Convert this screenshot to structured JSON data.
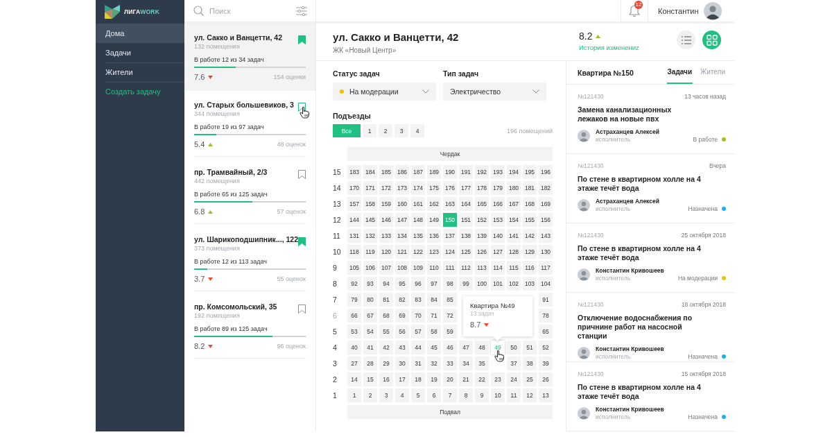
{
  "logo": {
    "prefix": "ЛИГА",
    "suffix": "WORK"
  },
  "nav": [
    {
      "label": "Дома",
      "selected": true,
      "kind": "item"
    },
    {
      "label": "Задачи",
      "selected": false,
      "kind": "item"
    },
    {
      "label": "Жители",
      "selected": false,
      "kind": "item"
    },
    {
      "label": "Создать задачу",
      "selected": false,
      "kind": "action"
    }
  ],
  "search": {
    "placeholder": "Поиск"
  },
  "houses": [
    {
      "title": "ул. Сакко и Ванцетти, 42",
      "rooms": "132 помещения",
      "progress": "В работе 12 из 34 задач",
      "level": 0.37,
      "rating": "7.6",
      "rising": false,
      "votes": "154 оценки",
      "selected": true,
      "bookmarked": true,
      "hovered": false
    },
    {
      "title": "ул. Старых большевиков, 3",
      "rooms": "344 помещения",
      "progress": "В работе 19 из 97 задач",
      "level": 0.2,
      "rating": "5.4",
      "rising": true,
      "votes": "48 оценок",
      "selected": false,
      "bookmarked": false,
      "hovered": true
    },
    {
      "title": "пр. Трамвайный, 2/3",
      "rooms": "442 помещения",
      "progress": "В работе 65 из 125 задач",
      "level": 0.52,
      "rating": "6.8",
      "rising": true,
      "votes": "57 оценок",
      "selected": false,
      "bookmarked": false,
      "hovered": false
    },
    {
      "title": "ул. Шарикоподшипник..., 122",
      "rooms": "373 помещения",
      "progress": "В работе 12 из 113 задач",
      "level": 0.12,
      "rating": "3.7",
      "rising": false,
      "votes": "55 оценок",
      "selected": false,
      "bookmarked": true,
      "hovered": false
    },
    {
      "title": "пр. Комсомольский, 35",
      "rooms": "192 помещения",
      "progress": "В работе 89 из 125 задач",
      "level": 0.7,
      "rating": "8.2",
      "rising": false,
      "votes": "96 оценок",
      "selected": false,
      "bookmarked": false,
      "hovered": false
    }
  ],
  "topbar": {
    "notifications": "12",
    "user": "Константин"
  },
  "house": {
    "title": "ул. Сакко и Ванцетти, 42",
    "subtitle": "ЖК «Новый Центр»",
    "rating": "8.2",
    "rising": true,
    "history_link": "История изменениz"
  },
  "view_modes": [
    {
      "kind": "list",
      "selected": false
    },
    {
      "kind": "grid",
      "selected": true
    }
  ],
  "filters": [
    {
      "label": "Статус задач",
      "value": "На модерации",
      "color": "#f5c000"
    },
    {
      "label": "Тип задач",
      "value": "Электричество"
    }
  ],
  "entrances": {
    "label": "Подъезды",
    "buttons": [
      {
        "label": "Все",
        "selected": true
      },
      {
        "label": "1",
        "selected": false
      },
      {
        "label": "2",
        "selected": false
      },
      {
        "label": "3",
        "selected": false
      },
      {
        "label": "4",
        "selected": false
      }
    ],
    "count": "196 помещений"
  },
  "building": {
    "attic": "Чердак",
    "basement": "Подвал",
    "floors": [
      {
        "floor": "15",
        "dimmed": false,
        "cells": [
          {
            "n": "183",
            "selected": false,
            "hovered": false
          },
          {
            "n": "184",
            "selected": false,
            "hovered": false
          },
          {
            "n": "185",
            "selected": false,
            "hovered": false
          },
          {
            "n": "186",
            "selected": false,
            "hovered": false
          },
          {
            "n": "187",
            "selected": false,
            "hovered": false
          },
          {
            "n": "189",
            "selected": false,
            "hovered": false
          },
          {
            "n": "190",
            "selected": false,
            "hovered": false
          },
          {
            "n": "191",
            "selected": false,
            "hovered": false
          },
          {
            "n": "192",
            "selected": false,
            "hovered": false
          },
          {
            "n": "193",
            "selected": false,
            "hovered": false
          },
          {
            "n": "194",
            "selected": false,
            "hovered": false
          },
          {
            "n": "195",
            "selected": false,
            "hovered": false
          },
          {
            "n": "196",
            "selected": false,
            "hovered": false
          }
        ]
      },
      {
        "floor": "14",
        "dimmed": false,
        "cells": [
          {
            "n": "170",
            "selected": false,
            "hovered": false
          },
          {
            "n": "171",
            "selected": false,
            "hovered": false
          },
          {
            "n": "172",
            "selected": false,
            "hovered": false
          },
          {
            "n": "173",
            "selected": false,
            "hovered": false
          },
          {
            "n": "174",
            "selected": false,
            "hovered": false
          },
          {
            "n": "175",
            "selected": false,
            "hovered": false
          },
          {
            "n": "176",
            "selected": false,
            "hovered": false
          },
          {
            "n": "177",
            "selected": false,
            "hovered": false
          },
          {
            "n": "178",
            "selected": false,
            "hovered": false
          },
          {
            "n": "179",
            "selected": false,
            "hovered": false
          },
          {
            "n": "180",
            "selected": false,
            "hovered": false
          },
          {
            "n": "181",
            "selected": false,
            "hovered": false
          },
          {
            "n": "182",
            "selected": false,
            "hovered": false
          }
        ]
      },
      {
        "floor": "13",
        "dimmed": false,
        "cells": [
          {
            "n": "157",
            "selected": false,
            "hovered": false
          },
          {
            "n": "158",
            "selected": false,
            "hovered": false
          },
          {
            "n": "159",
            "selected": false,
            "hovered": false
          },
          {
            "n": "160",
            "selected": false,
            "hovered": false
          },
          {
            "n": "161",
            "selected": false,
            "hovered": false
          },
          {
            "n": "162",
            "selected": false,
            "hovered": false
          },
          {
            "n": "163",
            "selected": false,
            "hovered": false
          },
          {
            "n": "164",
            "selected": false,
            "hovered": false
          },
          {
            "n": "165",
            "selected": false,
            "hovered": false
          },
          {
            "n": "166",
            "selected": false,
            "hovered": false
          },
          {
            "n": "167",
            "selected": false,
            "hovered": false
          },
          {
            "n": "168",
            "selected": false,
            "hovered": false
          },
          {
            "n": "169",
            "selected": false,
            "hovered": false
          }
        ]
      },
      {
        "floor": "12",
        "dimmed": false,
        "cells": [
          {
            "n": "144",
            "selected": false,
            "hovered": false
          },
          {
            "n": "145",
            "selected": false,
            "hovered": false
          },
          {
            "n": "146",
            "selected": false,
            "hovered": false
          },
          {
            "n": "147",
            "selected": false,
            "hovered": false
          },
          {
            "n": "148",
            "selected": false,
            "hovered": false
          },
          {
            "n": "149",
            "selected": false,
            "hovered": false
          },
          {
            "n": "150",
            "selected": true,
            "hovered": false
          },
          {
            "n": "151",
            "selected": false,
            "hovered": false
          },
          {
            "n": "152",
            "selected": false,
            "hovered": false
          },
          {
            "n": "153",
            "selected": false,
            "hovered": false
          },
          {
            "n": "154",
            "selected": false,
            "hovered": false
          },
          {
            "n": "155",
            "selected": false,
            "hovered": false
          },
          {
            "n": "156",
            "selected": false,
            "hovered": false
          }
        ]
      },
      {
        "floor": "11",
        "dimmed": false,
        "cells": [
          {
            "n": "131",
            "selected": false,
            "hovered": false
          },
          {
            "n": "132",
            "selected": false,
            "hovered": false
          },
          {
            "n": "133",
            "selected": false,
            "hovered": false
          },
          {
            "n": "134",
            "selected": false,
            "hovered": false
          },
          {
            "n": "135",
            "selected": false,
            "hovered": false
          },
          {
            "n": "136",
            "selected": false,
            "hovered": false
          },
          {
            "n": "137",
            "selected": false,
            "hovered": false
          },
          {
            "n": "138",
            "selected": false,
            "hovered": false
          },
          {
            "n": "139",
            "selected": false,
            "hovered": false
          },
          {
            "n": "140",
            "selected": false,
            "hovered": false
          },
          {
            "n": "141",
            "selected": false,
            "hovered": false
          },
          {
            "n": "142",
            "selected": false,
            "hovered": false
          },
          {
            "n": "143",
            "selected": false,
            "hovered": false
          }
        ]
      },
      {
        "floor": "10",
        "dimmed": false,
        "cells": [
          {
            "n": "118",
            "selected": false,
            "hovered": false
          },
          {
            "n": "119",
            "selected": false,
            "hovered": false
          },
          {
            "n": "120",
            "selected": false,
            "hovered": false
          },
          {
            "n": "121",
            "selected": false,
            "hovered": false
          },
          {
            "n": "122",
            "selected": false,
            "hovered": false
          },
          {
            "n": "123",
            "selected": false,
            "hovered": false
          },
          {
            "n": "124",
            "selected": false,
            "hovered": false
          },
          {
            "n": "125",
            "selected": false,
            "hovered": false
          },
          {
            "n": "126",
            "selected": false,
            "hovered": false
          },
          {
            "n": "127",
            "selected": false,
            "hovered": false
          },
          {
            "n": "128",
            "selected": false,
            "hovered": false
          },
          {
            "n": "129",
            "selected": false,
            "hovered": false
          },
          {
            "n": "130",
            "selected": false,
            "hovered": false
          }
        ]
      },
      {
        "floor": "9",
        "dimmed": false,
        "cells": [
          {
            "n": "105",
            "selected": false,
            "hovered": false
          },
          {
            "n": "106",
            "selected": false,
            "hovered": false
          },
          {
            "n": "107",
            "selected": false,
            "hovered": false
          },
          {
            "n": "108",
            "selected": false,
            "hovered": false
          },
          {
            "n": "109",
            "selected": false,
            "hovered": false
          },
          {
            "n": "110",
            "selected": false,
            "hovered": false
          },
          {
            "n": "111",
            "selected": false,
            "hovered": false
          },
          {
            "n": "112",
            "selected": false,
            "hovered": false
          },
          {
            "n": "113",
            "selected": false,
            "hovered": false
          },
          {
            "n": "114",
            "selected": false,
            "hovered": false
          },
          {
            "n": "115",
            "selected": false,
            "hovered": false
          },
          {
            "n": "116",
            "selected": false,
            "hovered": false
          },
          {
            "n": "117",
            "selected": false,
            "hovered": false
          }
        ]
      },
      {
        "floor": "8",
        "dimmed": false,
        "cells": [
          {
            "n": "92",
            "selected": false,
            "hovered": false
          },
          {
            "n": "93",
            "selected": false,
            "hovered": false
          },
          {
            "n": "94",
            "selected": false,
            "hovered": false
          },
          {
            "n": "95",
            "selected": false,
            "hovered": false
          },
          {
            "n": "96",
            "selected": false,
            "hovered": false
          },
          {
            "n": "97",
            "selected": false,
            "hovered": false
          },
          {
            "n": "98",
            "selected": false,
            "hovered": false
          },
          {
            "n": "99",
            "selected": false,
            "hovered": false
          },
          {
            "n": "100",
            "selected": false,
            "hovered": false
          },
          {
            "n": "101",
            "selected": false,
            "hovered": false
          },
          {
            "n": "102",
            "selected": false,
            "hovered": false
          },
          {
            "n": "103",
            "selected": false,
            "hovered": false
          },
          {
            "n": "104",
            "selected": false,
            "hovered": false
          }
        ]
      },
      {
        "floor": "7",
        "dimmed": false,
        "cells": [
          {
            "n": "79",
            "selected": false,
            "hovered": false
          },
          {
            "n": "80",
            "selected": false,
            "hovered": false
          },
          {
            "n": "81",
            "selected": false,
            "hovered": false
          },
          {
            "n": "82",
            "selected": false,
            "hovered": false
          },
          {
            "n": "83",
            "selected": false,
            "hovered": false
          },
          {
            "n": "84",
            "selected": false,
            "hovered": false
          },
          {
            "n": "85",
            "selected": false,
            "hovered": false
          },
          null,
          null,
          null,
          null,
          null,
          {
            "n": "91",
            "selected": false,
            "hovered": false
          }
        ]
      },
      {
        "floor": "6",
        "dimmed": true,
        "cells": [
          {
            "n": "66",
            "selected": false,
            "hovered": false
          },
          {
            "n": "67",
            "selected": false,
            "hovered": false
          },
          {
            "n": "68",
            "selected": false,
            "hovered": false
          },
          {
            "n": "69",
            "selected": false,
            "hovered": false
          },
          {
            "n": "70",
            "selected": false,
            "hovered": false
          },
          {
            "n": "71",
            "selected": false,
            "hovered": false
          },
          {
            "n": "72",
            "selected": false,
            "hovered": false
          },
          null,
          null,
          null,
          null,
          null,
          {
            "n": "78",
            "selected": false,
            "hovered": false
          }
        ]
      },
      {
        "floor": "5",
        "dimmed": false,
        "cells": [
          {
            "n": "53",
            "selected": false,
            "hovered": false
          },
          {
            "n": "54",
            "selected": false,
            "hovered": false
          },
          {
            "n": "55",
            "selected": false,
            "hovered": false
          },
          {
            "n": "56",
            "selected": false,
            "hovered": false
          },
          {
            "n": "57",
            "selected": false,
            "hovered": false
          },
          {
            "n": "58",
            "selected": false,
            "hovered": false
          },
          {
            "n": "59",
            "selected": false,
            "hovered": false
          },
          null,
          null,
          null,
          null,
          null,
          {
            "n": "65",
            "selected": false,
            "hovered": false
          }
        ]
      },
      {
        "floor": "4",
        "dimmed": false,
        "cells": [
          {
            "n": "40",
            "selected": false,
            "hovered": false
          },
          {
            "n": "41",
            "selected": false,
            "hovered": false
          },
          {
            "n": "42",
            "selected": false,
            "hovered": false
          },
          {
            "n": "43",
            "selected": false,
            "hovered": false
          },
          {
            "n": "44",
            "selected": false,
            "hovered": false
          },
          {
            "n": "45",
            "selected": false,
            "hovered": false
          },
          {
            "n": "46",
            "selected": false,
            "hovered": false
          },
          {
            "n": "47",
            "selected": false,
            "hovered": false
          },
          {
            "n": "48",
            "selected": false,
            "hovered": false
          },
          {
            "n": "49",
            "selected": false,
            "hovered": true
          },
          {
            "n": "50",
            "selected": false,
            "hovered": false
          },
          {
            "n": "51",
            "selected": false,
            "hovered": false
          },
          {
            "n": "52",
            "selected": false,
            "hovered": false
          }
        ]
      },
      {
        "floor": "3",
        "dimmed": false,
        "cells": [
          {
            "n": "27",
            "selected": false,
            "hovered": false
          },
          {
            "n": "28",
            "selected": false,
            "hovered": false
          },
          {
            "n": "29",
            "selected": false,
            "hovered": false
          },
          {
            "n": "30",
            "selected": false,
            "hovered": false
          },
          {
            "n": "31",
            "selected": false,
            "hovered": false
          },
          {
            "n": "32",
            "selected": false,
            "hovered": false
          },
          {
            "n": "33",
            "selected": false,
            "hovered": false
          },
          {
            "n": "34",
            "selected": false,
            "hovered": false
          },
          {
            "n": "35",
            "selected": false,
            "hovered": false
          },
          null,
          {
            "n": "37",
            "selected": false,
            "hovered": false
          },
          {
            "n": "38",
            "selected": false,
            "hovered": false
          },
          {
            "n": "39",
            "selected": false,
            "hovered": false
          }
        ]
      },
      {
        "floor": "2",
        "dimmed": false,
        "cells": [
          {
            "n": "14",
            "selected": false,
            "hovered": false
          },
          {
            "n": "15",
            "selected": false,
            "hovered": false
          },
          {
            "n": "16",
            "selected": false,
            "hovered": false
          },
          {
            "n": "17",
            "selected": false,
            "hovered": false
          },
          {
            "n": "18",
            "selected": false,
            "hovered": false
          },
          {
            "n": "19",
            "selected": false,
            "hovered": false
          },
          {
            "n": "20",
            "selected": false,
            "hovered": false
          },
          {
            "n": "21",
            "selected": false,
            "hovered": false
          },
          {
            "n": "22",
            "selected": false,
            "hovered": false
          },
          {
            "n": "23",
            "selected": false,
            "hovered": false
          },
          {
            "n": "24",
            "selected": false,
            "hovered": false
          },
          {
            "n": "25",
            "selected": false,
            "hovered": false
          },
          {
            "n": "26",
            "selected": false,
            "hovered": false
          }
        ]
      },
      {
        "floor": "1",
        "dimmed": false,
        "cells": [
          {
            "n": "1",
            "selected": false,
            "hovered": false
          },
          {
            "n": "2",
            "selected": false,
            "hovered": false
          },
          {
            "n": "3",
            "selected": false,
            "hovered": false
          },
          {
            "n": "4",
            "selected": false,
            "hovered": false
          },
          {
            "n": "5",
            "selected": false,
            "hovered": false
          },
          {
            "n": "6",
            "selected": false,
            "hovered": false
          },
          {
            "n": "7",
            "selected": false,
            "hovered": false
          },
          {
            "n": "8",
            "selected": false,
            "hovered": false
          },
          {
            "n": "9",
            "selected": false,
            "hovered": false
          },
          {
            "n": "10",
            "selected": false,
            "hovered": false
          },
          {
            "n": "11",
            "selected": false,
            "hovered": false
          },
          {
            "n": "12",
            "selected": false,
            "hovered": false
          },
          {
            "n": "13",
            "selected": false,
            "hovered": false
          }
        ]
      }
    ],
    "tooltip": {
      "title": "Квартира №49",
      "tasks": "13 задач",
      "rating": "8.7",
      "rising": false
    }
  },
  "apartment": {
    "title": "Квартира №150",
    "tabs": [
      {
        "label": "Задачи",
        "selected": true
      },
      {
        "label": "Жители",
        "selected": false
      }
    ],
    "tasks": [
      {
        "id": "№121430",
        "time": "13 часов назад",
        "title": "Замена канализационных лежаков на новые пвх",
        "assignee": "Астраханцев Алексей",
        "role": "исполнитель",
        "status": "В работе",
        "color": "#9cc41c"
      },
      {
        "id": "№121430",
        "time": "Вчера",
        "title": "По стене в квартирном холле на 4 этаже течёт вода",
        "assignee": "Астраханцев Алексей",
        "role": "исполнитель",
        "status": "Назначена",
        "color": "#1ab3e8"
      },
      {
        "id": "№121430",
        "time": "25 октября 2018",
        "title": "По стене в квартирном холле на 4 этаже течёт вода",
        "assignee": "Константин Кривошеев",
        "role": "исполнитель",
        "status": "На модерации",
        "color": "#f5c000"
      },
      {
        "id": "№121430",
        "time": "18 октября 2018",
        "title": "Отключение водоснабжения по причнине работ на насосной станции",
        "assignee": "Константин Кривошеев",
        "role": "исполнитель",
        "status": "Назначена",
        "color": "#1ab3e8"
      },
      {
        "id": "№121430",
        "time": "15 октября 2018",
        "title": "По стене в квартирном холле на 4 этаже течёт вода",
        "assignee": "Константин Кривошеев",
        "role": "исполнитель",
        "status": "Назначена",
        "color": "#1ab3e8"
      }
    ]
  }
}
